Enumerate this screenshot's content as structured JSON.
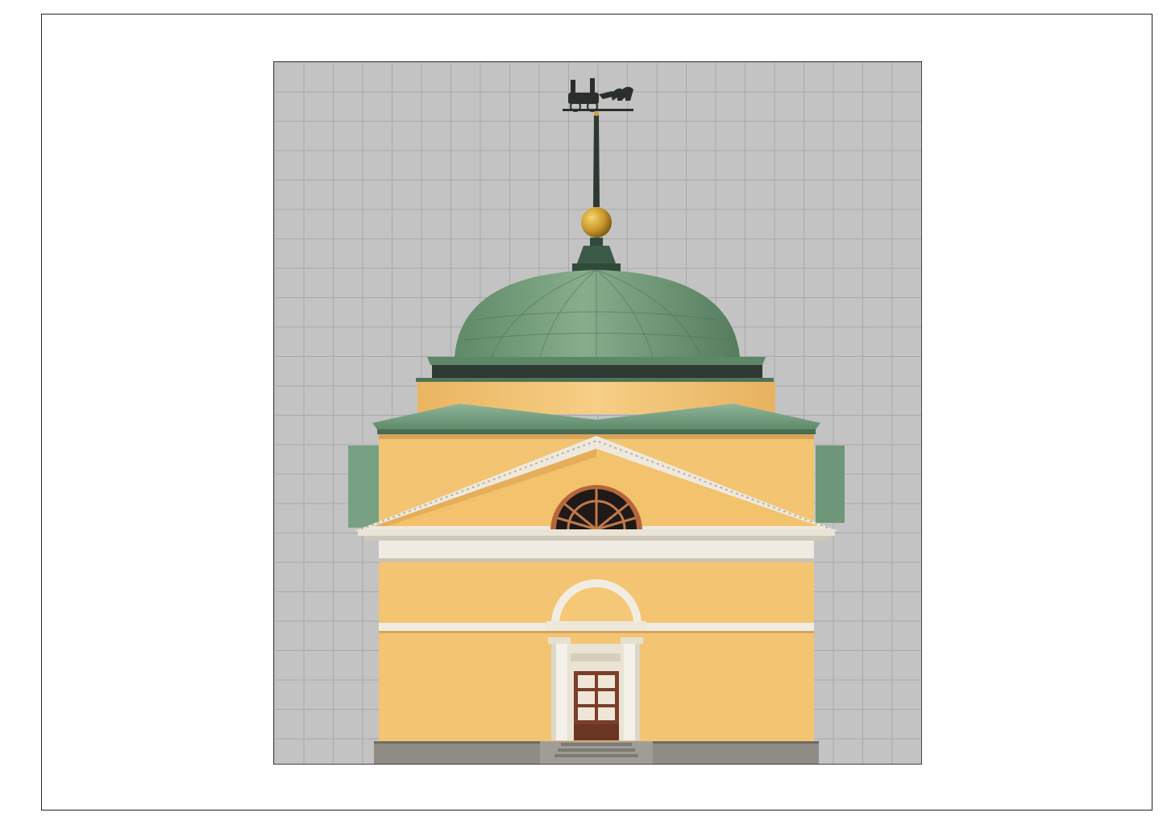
{
  "sheet": {
    "background_color": "#ffffff",
    "frame_color": "#222222"
  },
  "drawing": {
    "grid_background": "#c3c3c3",
    "grid_lines": "#a9a9a9",
    "colors": {
      "facade": "#f3c471",
      "facade_shadow": "#e3a958",
      "cornice": "#eae7df",
      "copper_roof": "#76a07c",
      "copper_dark": "#46644e",
      "gold_ball": "#d2a234",
      "granite_plinth": "#8f8c86",
      "spire": "#2c3830",
      "door": "#8a4a32"
    },
    "icons": [
      "weathervane-carriage-icon",
      "lunette-window-icon",
      "column-icon",
      "door-icon"
    ]
  }
}
